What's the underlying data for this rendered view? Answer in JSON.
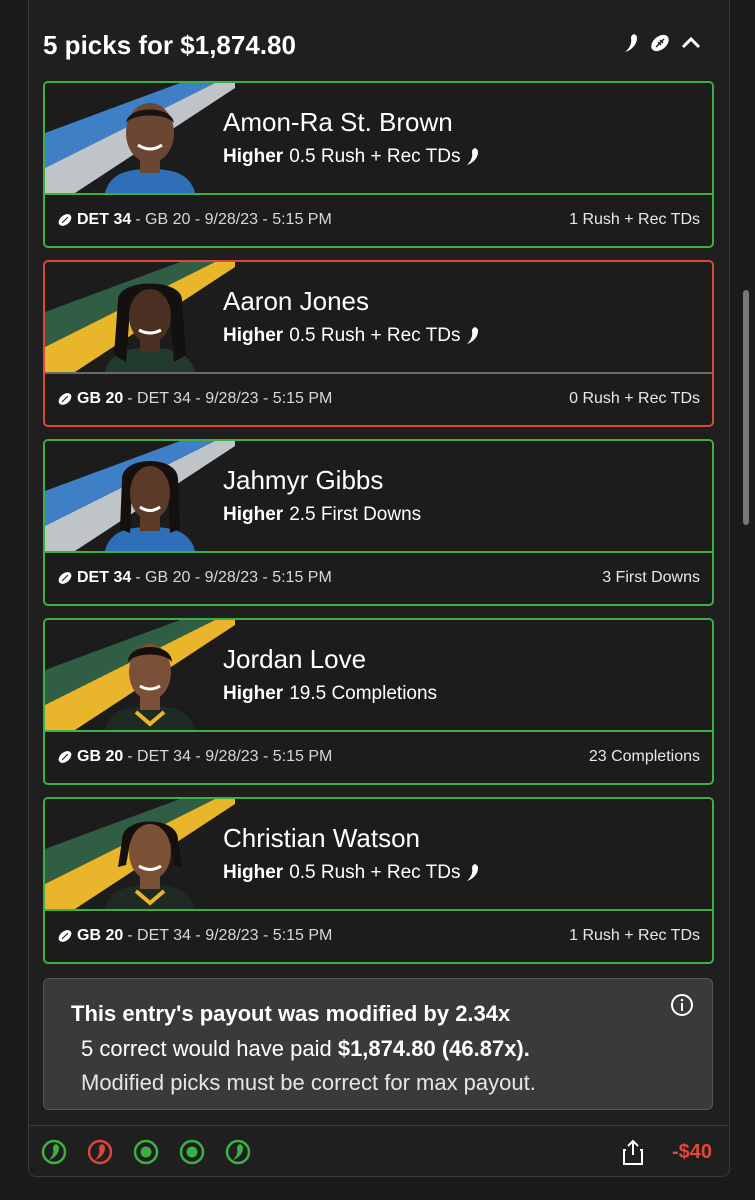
{
  "header": {
    "title": "5 picks for $1,874.80"
  },
  "picks": [
    {
      "name": "Amon-Ra St. Brown",
      "direction": "Higher",
      "line": "0.5 Rush + Rec TDs",
      "team": "DET 34",
      "opponent": "- GB 20 - 9/28/23 - 5:15 PM",
      "result": "1 Rush + Rec TDs",
      "status": "win"
    },
    {
      "name": "Aaron Jones",
      "direction": "Higher",
      "line": "0.5 Rush + Rec TDs",
      "team": "GB 20",
      "opponent": "- DET 34 - 9/28/23 - 5:15 PM",
      "result": "0 Rush + Rec TDs",
      "status": "loss"
    },
    {
      "name": "Jahmyr Gibbs",
      "direction": "Higher",
      "line": "2.5 First Downs",
      "team": "DET 34",
      "opponent": "- GB 20 - 9/28/23 - 5:15 PM",
      "result": "3 First Downs",
      "status": "win"
    },
    {
      "name": "Jordan Love",
      "direction": "Higher",
      "line": "19.5 Completions",
      "team": "GB 20",
      "opponent": "- DET 34 - 9/28/23 - 5:15 PM",
      "result": "23 Completions",
      "status": "win"
    },
    {
      "name": "Christian Watson",
      "direction": "Higher",
      "line": "0.5 Rush + Rec TDs",
      "team": "GB 20",
      "opponent": "- DET 34 - 9/28/23 - 5:15 PM",
      "result": "1 Rush + Rec TDs",
      "status": "win"
    }
  ],
  "notice": {
    "title": "This entry's payout was modified by 2.34x",
    "line1_prefix": "5 correct would have paid ",
    "line1_amount": "$1,874.80 (46.87x).",
    "line2": "Modified picks must be correct for max payout."
  },
  "footer": {
    "amount": "-$40"
  },
  "colors": {
    "win": "#3cb043",
    "loss": "#d9483b",
    "det_blue": "#3f7fc6",
    "gb_green": "#2f5e45",
    "gb_gold": "#e9b52b"
  }
}
